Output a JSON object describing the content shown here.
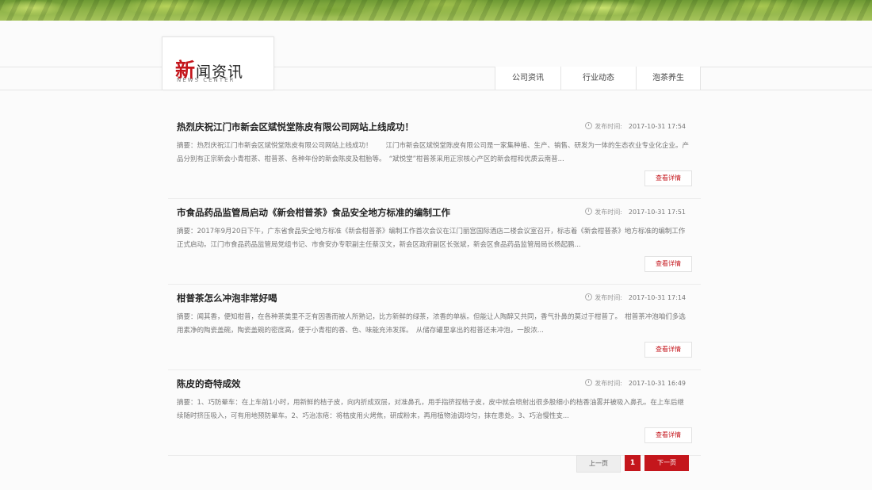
{
  "header": {
    "logo_first": "新",
    "logo_rest": "闻资讯",
    "logo_sub": "NEWS CENTER"
  },
  "nav": {
    "items": [
      {
        "label": "公司资讯"
      },
      {
        "label": "行业动态"
      },
      {
        "label": "泡茶养生"
      }
    ]
  },
  "news": {
    "time_label": "发布时间:",
    "detail_label": "查看详情",
    "items": [
      {
        "title": "热烈庆祝江门市新会区斌悦堂陈皮有限公司网站上线成功！",
        "time": "2017-10-31 17:54",
        "summary": "摘要：热烈庆祝江门市新会区斌悦堂陈皮有限公司网站上线成功！　　江门市新会区斌悦堂陈皮有限公司是一家集种植、生产、销售、研发为一体的生态农业专业化企业。产品分别有正宗新会小青柑茶、柑普茶、各种年份的新会陈皮及柑胎等。　“斌悦堂”柑普茶采用正宗核心产区的新会柑和优质云南普..."
      },
      {
        "title": "市食品药品监管局启动《新会柑普茶》食品安全地方标准的编制工作",
        "time": "2017-10-31 17:51",
        "summary": "摘要：2017年9月20日下午，广东省食品安全地方标准《新会柑普茶》编制工作首次会议在江门丽宫国际酒店二楼会议室召开，标志着《新会柑普茶》地方标准的编制工作正式启动。江门市食品药品监管局党组书记、市食安办专职副主任蔡汉文，新会区政府副区长张斌，新会区食品药品监管局局长杨起鹏..."
      },
      {
        "title": "柑普茶怎么冲泡非常好喝",
        "time": "2017-10-31 17:14",
        "summary": "摘要：闻其香，便知柑普，在各种茶类里不乏有因香而被人所熟记，比方新鲜的绿茶，浓香的单枞。但能让人陶醉又共同，香气扑鼻的莫过于柑普了。　柑普茶冲泡咱们多选用素净的陶瓷盖碗，陶瓷盖碗的密度高，便于小青柑的香、色、味能充沛发挥。　从储存罐里拿出的柑普还未冲泡，一股浓..."
      },
      {
        "title": "陈皮的奇特成效",
        "time": "2017-10-31 16:49",
        "summary": "摘要：1、巧防晕车：在上车前1小时，用新鲜的桔子皮，向内折成双层，对准鼻孔，用手指挤捏桔子皮，皮中就会喷射出很多股细小的桔香油雾并被吸入鼻孔。在上车后继续随时挤压吸入，可有用地预防晕车。2、巧治冻疮：将桔皮用火烤焦，研成粉末，再用植物油调均匀，抹在患处。3、巧治慢性支..."
      }
    ]
  },
  "pager": {
    "prev": "上一页",
    "current": "1",
    "next": "下一页"
  }
}
